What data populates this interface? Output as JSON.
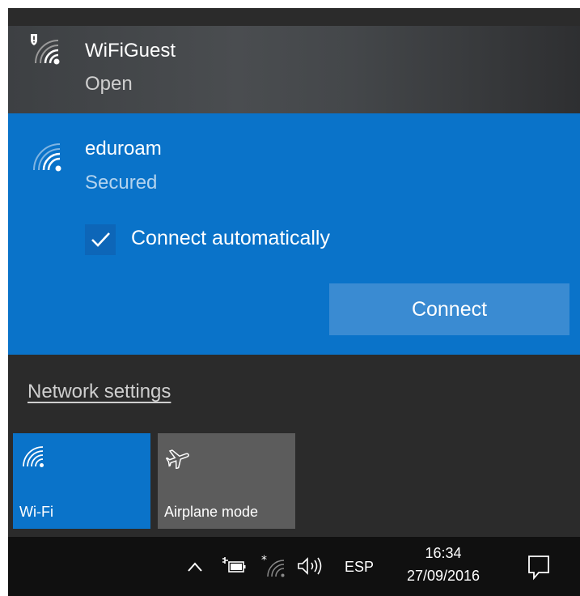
{
  "networks": [
    {
      "name": "WiFiGuest",
      "status": "Open",
      "icon": "wifi-shield-warning-icon"
    },
    {
      "name": "eduroam",
      "status": "Secured",
      "icon": "wifi-signal-icon",
      "connect_automatically": {
        "label": "Connect automatically",
        "checked": true
      },
      "connect_button": "Connect"
    }
  ],
  "network_settings_link": "Network settings",
  "quick_actions": [
    {
      "label": "Wi-Fi",
      "icon": "wifi-icon",
      "active": true
    },
    {
      "label": "Airplane mode",
      "icon": "airplane-icon",
      "active": false
    }
  ],
  "taskbar": {
    "tray_icons": [
      "chevron-up-icon",
      "battery-charging-icon",
      "wifi-tray-icon",
      "volume-icon"
    ],
    "language": "ESP",
    "time": "16:34",
    "date": "27/09/2016",
    "notification_icon": "action-center-icon"
  },
  "colors": {
    "accent": "#0a73c9",
    "flyout_bg": "#2b2b2b",
    "taskbar_bg": "#101010"
  }
}
